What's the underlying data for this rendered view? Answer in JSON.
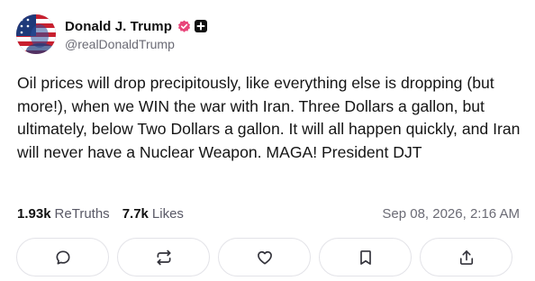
{
  "author": {
    "display_name": "Donald J. Trump",
    "handle": "@realDonaldTrump",
    "avatar_icon": "user-avatar-flag",
    "verified_icon": "verified-badge-icon",
    "verified_color": "#e8457a",
    "plus_icon": "plus-badge-icon"
  },
  "post": {
    "text": "Oil prices will drop precipitously, like everything else is dropping (but more!), when we WIN the war with Iran. Three Dollars a gallon, but ultimately, below Two Dollars a gallon. It will all happen quickly, and Iran will never have a Nuclear Weapon. MAGA! President DJT",
    "timestamp": "Sep 08, 2026, 2:16 AM"
  },
  "stats": {
    "retruths_count": "1.93k",
    "retruths_label": "ReTruths",
    "likes_count": "7.7k",
    "likes_label": "Likes"
  },
  "actions": [
    {
      "name": "reply",
      "icon": "reply-icon"
    },
    {
      "name": "retruth",
      "icon": "repost-icon"
    },
    {
      "name": "like",
      "icon": "heart-icon"
    },
    {
      "name": "bookmark",
      "icon": "bookmark-icon"
    },
    {
      "name": "share",
      "icon": "share-icon"
    }
  ]
}
